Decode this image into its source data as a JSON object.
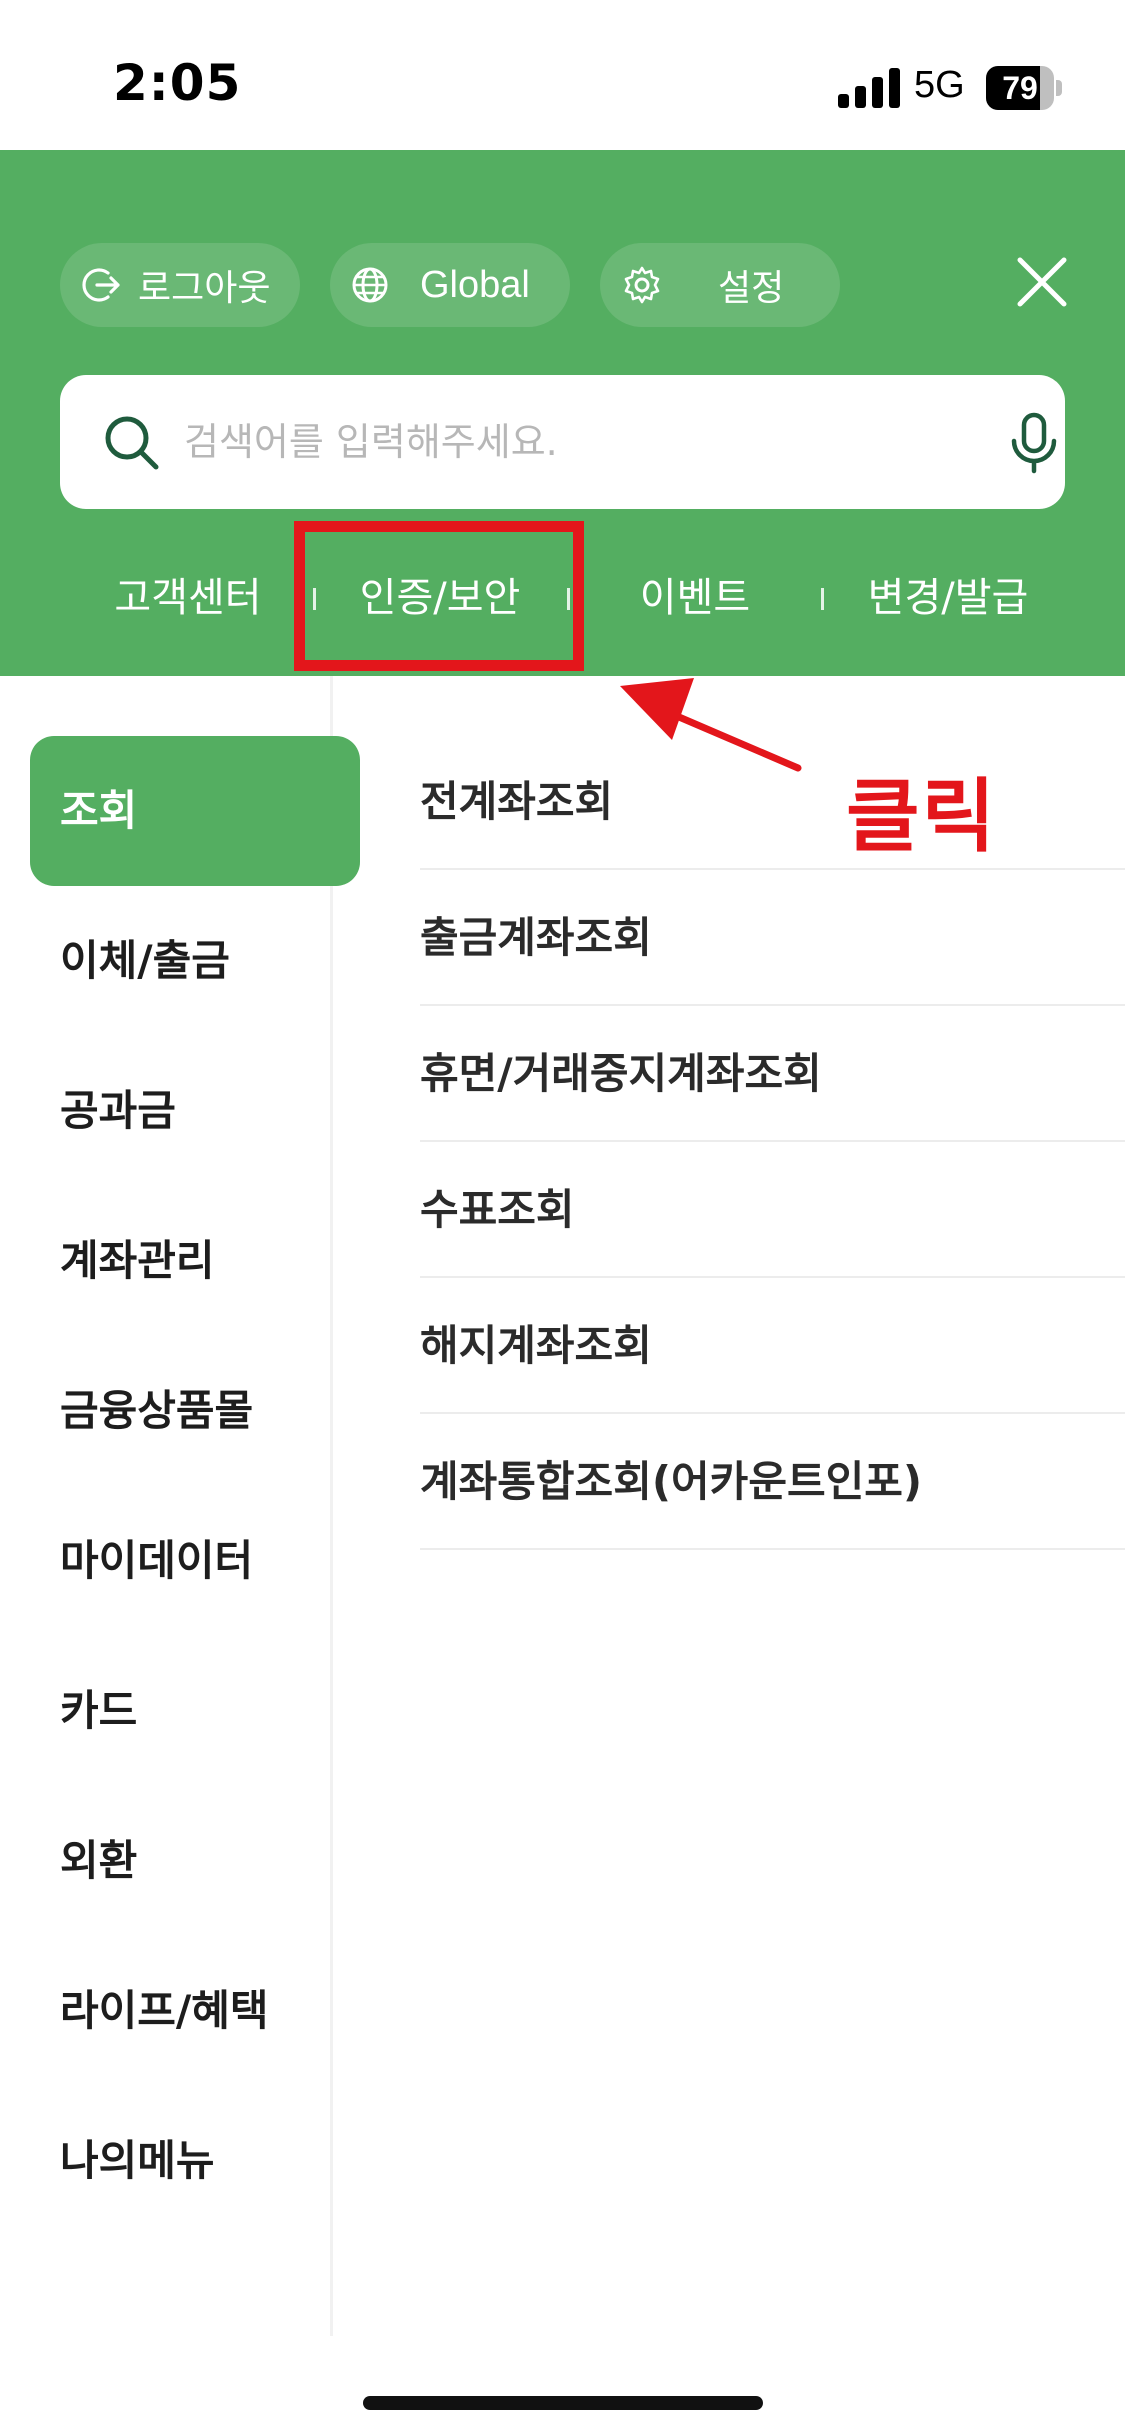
{
  "status_bar": {
    "time": "2:05",
    "network": "5G",
    "battery_level": "79",
    "battery_fraction": 0.79
  },
  "header": {
    "logout_label": "로그아웃",
    "global_label": "Global",
    "settings_label": "설정",
    "search": {
      "placeholder": "검색어를 입력해주세요."
    },
    "quick_links": [
      "고객센터",
      "인증/보안",
      "이벤트",
      "변경/발급"
    ],
    "background_color": "#54ae61"
  },
  "annotation": {
    "label": "클릭",
    "color": "#e3161b"
  },
  "sidebar": {
    "items": [
      "조회",
      "이체/출금",
      "공과금",
      "계좌관리",
      "금융상품몰",
      "마이데이터",
      "카드",
      "외환",
      "라이프/혜택",
      "나의메뉴"
    ],
    "active_index": 0
  },
  "menu": {
    "items": [
      "전계좌조회",
      "출금계좌조회",
      "휴면/거래중지계좌조회",
      "수표조회",
      "해지계좌조회",
      "계좌통합조회(어카운트인포)"
    ]
  }
}
